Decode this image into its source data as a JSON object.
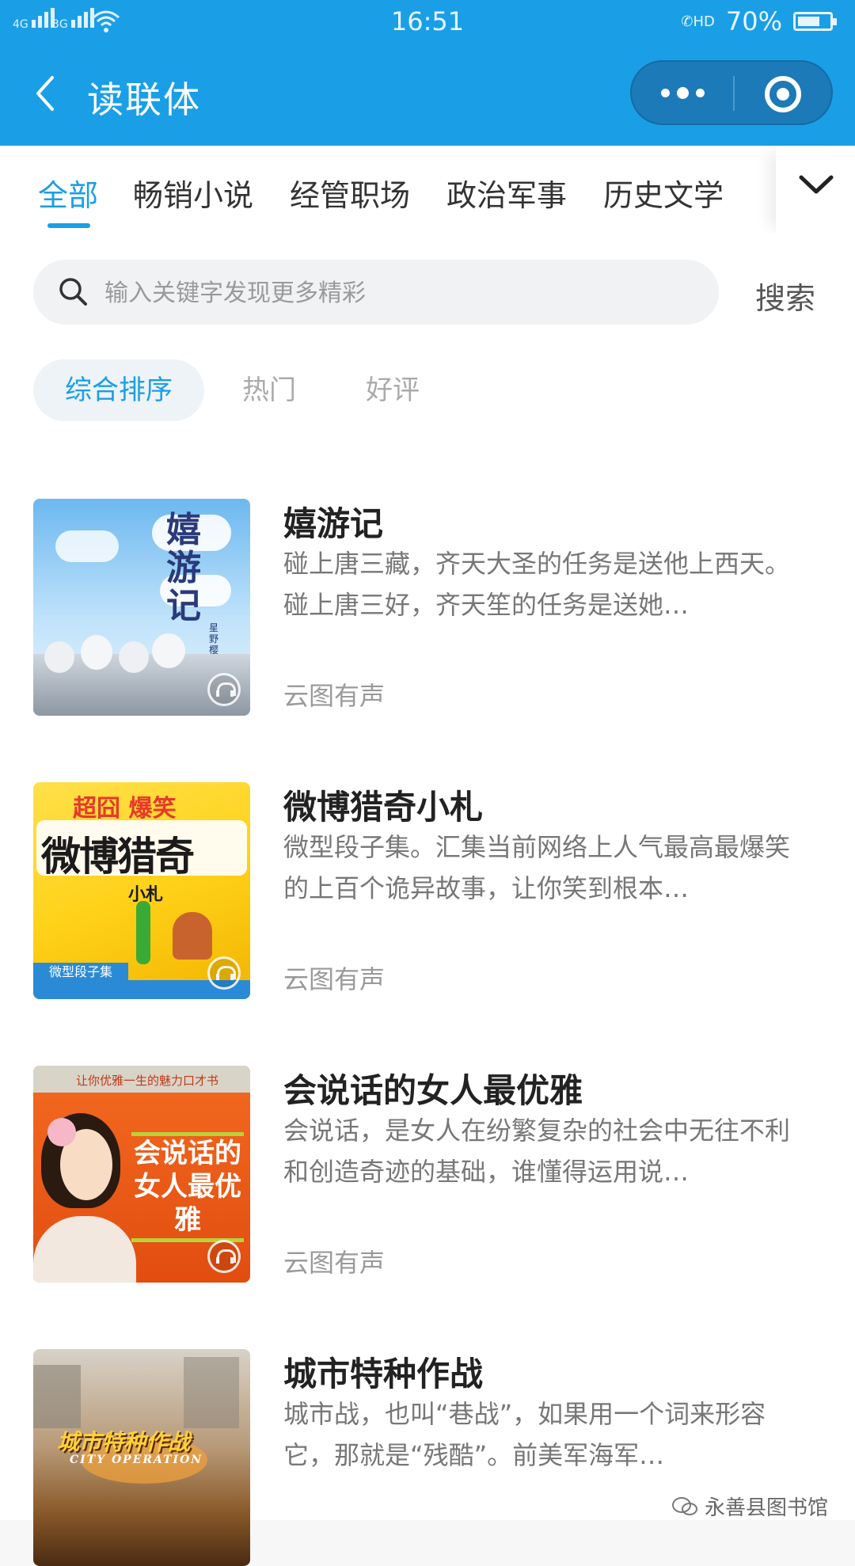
{
  "status_bar": {
    "network_left": "4G",
    "network_right": "3G",
    "time": "16:51",
    "call_label": "HD",
    "battery": "70%"
  },
  "nav": {
    "back_icon": "chevron-left-icon",
    "title": "读联体",
    "menu_icon": "more-dots-icon",
    "close_icon": "target-circle-icon"
  },
  "tabs": [
    {
      "label": "全部",
      "active": true
    },
    {
      "label": "畅销小说"
    },
    {
      "label": "经管职场"
    },
    {
      "label": "政治军事"
    },
    {
      "label": "历史文学"
    }
  ],
  "tabs_more_icon": "chevron-down-icon",
  "search": {
    "placeholder": "输入关键字发现更多精彩",
    "button": "搜索",
    "icon": "search-icon"
  },
  "sort": [
    {
      "label": "综合排序",
      "active": true
    },
    {
      "label": "热门"
    },
    {
      "label": "好评"
    }
  ],
  "books": [
    {
      "title": "嬉游记",
      "desc": "碰上唐三藏，齐天大圣的任务是送他上西天。碰上唐三好，齐天笙的任务是送她…",
      "source": "云图有声",
      "cover_text": "嬉游记",
      "cover_author": "星野樱",
      "cover_colors": [
        "#6db8ef",
        "#d8eefc"
      ]
    },
    {
      "title": "微博猎奇小札",
      "desc": "微型段子集。汇集当前网络上人气最高最爆笑的上百个诡异故事，让你笑到根本…",
      "source": "云图有声",
      "cover_text_top": "超囧 爆笑",
      "cover_text": "微博猎奇",
      "cover_sub": "小札",
      "cover_tag": "微型段子集",
      "cover_colors": [
        "#ffd21a",
        "#f2b400"
      ]
    },
    {
      "title": "会说话的女人最优雅",
      "desc": "会说话，是女人在纷繁复杂的社会中无往不利和创造奇迹的基础，谁懂得运用说…",
      "source": "云图有声",
      "cover_text_top": "让你优雅一生的魅力口才书",
      "cover_text": "会说话的女人最优雅",
      "cover_colors": [
        "#f0641c",
        "#e24d10"
      ]
    },
    {
      "title": "城市特种作战",
      "desc": "城市战，也叫“巷战”，如果用一个词来形容它，那就是“残酷”。前美军海军…",
      "source": "云图有声",
      "cover_text": "城市特种作战",
      "cover_sub": "CITY OPERATION",
      "cover_colors": [
        "#c9b9a4",
        "#8a5a2a"
      ]
    }
  ],
  "watermark": "永善县图书馆",
  "colors": {
    "accent": "#1a9fe6",
    "title_text": "#222222",
    "desc_text": "#777777"
  }
}
